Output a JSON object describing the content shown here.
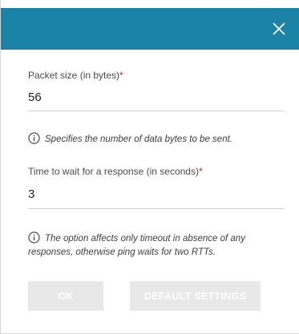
{
  "dialog": {
    "close_icon": "close-icon",
    "header_color": "#1b84a6"
  },
  "packet_size": {
    "label": "Packet size (in bytes)",
    "required_mark": "*",
    "value": "56",
    "hint": "Specifies the number of data bytes to be sent.",
    "hint_icon": "info-icon"
  },
  "wait_time": {
    "label": "Time to wait for a response (in seconds)",
    "required_mark": "*",
    "value": "3",
    "hint": "The option affects only timeout in absence of any responses, otherwise ping waits for two RTTs.",
    "hint_icon": "info-icon"
  },
  "buttons": {
    "ok_label": "OK",
    "default_label": "DEFAULT SETTINGS"
  }
}
